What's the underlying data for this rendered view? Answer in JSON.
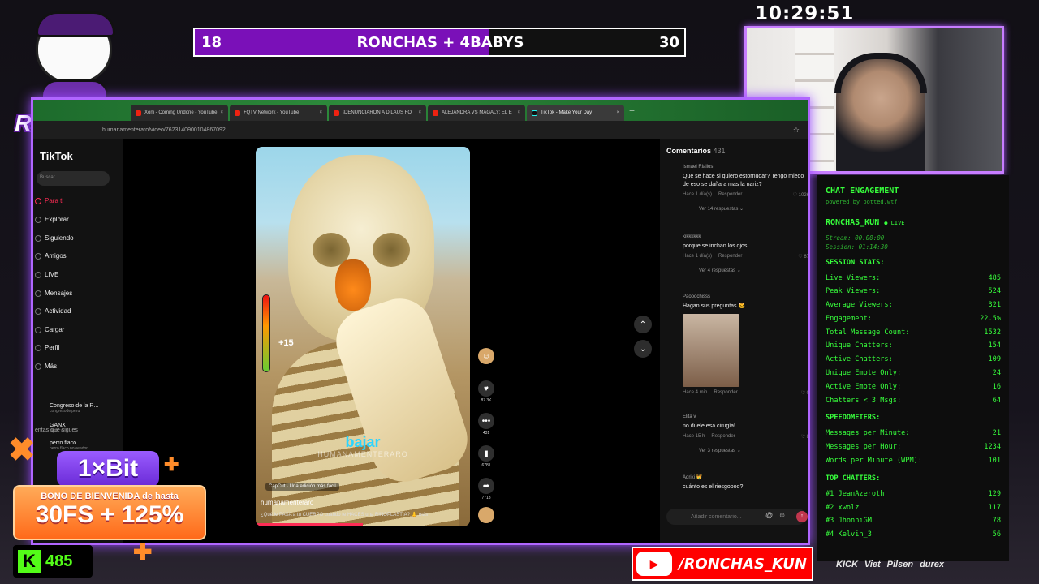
{
  "scorebar": {
    "left_score": "18",
    "title": "RONCHAS + 4BABYS",
    "right_score": "30",
    "progress_fraction": 0.6
  },
  "clock": "10:29:51",
  "mascot": {
    "name": "RONCHAS"
  },
  "browser": {
    "tabs": [
      {
        "label": "Xoni - Coming Undone - YouTube",
        "active": false
      },
      {
        "label": "+QTV Network - YouTube",
        "active": false
      },
      {
        "label": "¡DENUNCIARON A DILAUS FO",
        "active": false
      },
      {
        "label": "ALEJANDRA VS MAGALY: EL E",
        "active": false
      },
      {
        "label": "TikTok - Make Your Day",
        "active": true
      }
    ],
    "url": "humanamenteraro/video/7623140900104867092"
  },
  "tiktok": {
    "logo": "TikTok",
    "search_placeholder": "Buscar",
    "nav": [
      "Para ti",
      "Explorar",
      "Siguiendo",
      "Amigos",
      "LIVE",
      "Mensajes",
      "Actividad",
      "Cargar",
      "Perfil",
      "Más"
    ],
    "following_header": "entas que sigues",
    "following": [
      {
        "name": "Congreso de la R...",
        "handle": "congresodelperu"
      },
      {
        "name": "GANX",
        "handle": "ganx_yt_"
      },
      {
        "name": "perro flaco",
        "handle": "perro flaco nolveador"
      }
    ],
    "video": {
      "subtitle": "bajar",
      "watermark": "HUMANAMENTERARO",
      "meter_value": "+15",
      "capcut": "CapCut · Una edición más fácil",
      "author": "humanamenteraro",
      "caption": "¿Qué le PASA a tu CUERPO cuando te HACES una RINOPLASTIA? 👃  más",
      "progress_fraction": 0.5
    },
    "actions": [
      {
        "icon": "heart-icon",
        "glyph": "♥",
        "count": "87.3K"
      },
      {
        "icon": "comment-icon",
        "glyph": "•••",
        "count": "431"
      },
      {
        "icon": "bookmark-icon",
        "glyph": "▮",
        "count": "6781"
      },
      {
        "icon": "share-icon",
        "glyph": "➦",
        "count": "7718"
      }
    ],
    "comments_header": "Comentarios",
    "comments_count": "431",
    "comments": [
      {
        "user": "Ismael Riallos",
        "text": "Que se hace si quiero estornudar? Tengo miedo de eso se dañara mas la nariz?",
        "time": "Hace 1 día(s)",
        "reply": "Responder",
        "likes": "1026",
        "more": "Ver 14 respuestas ⌄",
        "avatar": "#d9161f"
      },
      {
        "user": "kikkkkkk",
        "text": "porque se inchan los ojos",
        "time": "Hace 1 día(s)",
        "reply": "Responder",
        "likes": "67",
        "more": "Ver 4 respuestas ⌄",
        "avatar": "#121212"
      },
      {
        "user": "Paooochisss",
        "text": "Hagan sus preguntas 🐱",
        "time": "Hace 4 min",
        "reply": "Responder",
        "likes": "0",
        "more": "",
        "avatar": "#3f4b78"
      },
      {
        "user": "Elita v",
        "text": "no duele esa cirugía!",
        "time": "Hace 15 h",
        "reply": "Responder",
        "likes": "8",
        "more": "Ver 3 respuestas ⌄",
        "avatar": "#6b6a3d"
      },
      {
        "user": "Adriki 👑",
        "text": "cuánto es el riesgoooo?",
        "time": "",
        "reply": "",
        "likes": "",
        "more": "",
        "avatar": "#888"
      }
    ],
    "comment_placeholder": "Añadir comentario..."
  },
  "stats": {
    "title": "CHAT ENGAGEMENT",
    "powered": "powered by botted.wtf",
    "user": "RONCHAS_KUN",
    "live_label": "● LIVE",
    "stream_time": "Stream: 00:00:00",
    "session_time": "Session: 01:14:30",
    "session_header": "SESSION STATS:",
    "session_rows": [
      {
        "label": "Live Viewers:",
        "value": "485"
      },
      {
        "label": "Peak Viewers:",
        "value": "524"
      },
      {
        "label": "Average Viewers:",
        "value": "321"
      },
      {
        "label": "Engagement:",
        "value": "22.5%"
      },
      {
        "label": "Total Message Count:",
        "value": "1532"
      },
      {
        "label": "Unique Chatters:",
        "value": "154"
      },
      {
        "label": "Active Chatters:",
        "value": "109"
      },
      {
        "label": "Unique Emote Only:",
        "value": "24"
      },
      {
        "label": "Active Emote Only:",
        "value": "16"
      },
      {
        "label": "Chatters < 3 Msgs:",
        "value": "64"
      }
    ],
    "speed_header": "SPEEDOMETERS:",
    "speed_rows": [
      {
        "label": "Messages per Minute:",
        "value": "21"
      },
      {
        "label": "Messages per Hour:",
        "value": "1234"
      },
      {
        "label": "Words per Minute (WPM):",
        "value": "101"
      }
    ],
    "top_header": "TOP CHATTERS:",
    "top_rows": [
      {
        "label": "#1 JeanAzeroth",
        "value": "129"
      },
      {
        "label": "#2 xwolz",
        "value": "117"
      },
      {
        "label": "#3 JhonniGM",
        "value": "78"
      },
      {
        "label": "#4 Kelvin_3",
        "value": "56"
      }
    ]
  },
  "promo": {
    "brand": "1×Bit",
    "line1": "BONO DE BIENVENIDA de hasta",
    "line2": "30FS + 125%"
  },
  "kick": {
    "logo": "K",
    "viewers": "485"
  },
  "youtube": {
    "handle": "/RONCHAS_KUN"
  },
  "sponsors": [
    "KICK",
    "Viet",
    "Pilsen",
    "durex"
  ],
  "colors": {
    "accent_purple": "#b066ff",
    "stats_green": "#37ff3c",
    "tiktok_red": "#fe2c55",
    "kick_green": "#53fc18"
  }
}
